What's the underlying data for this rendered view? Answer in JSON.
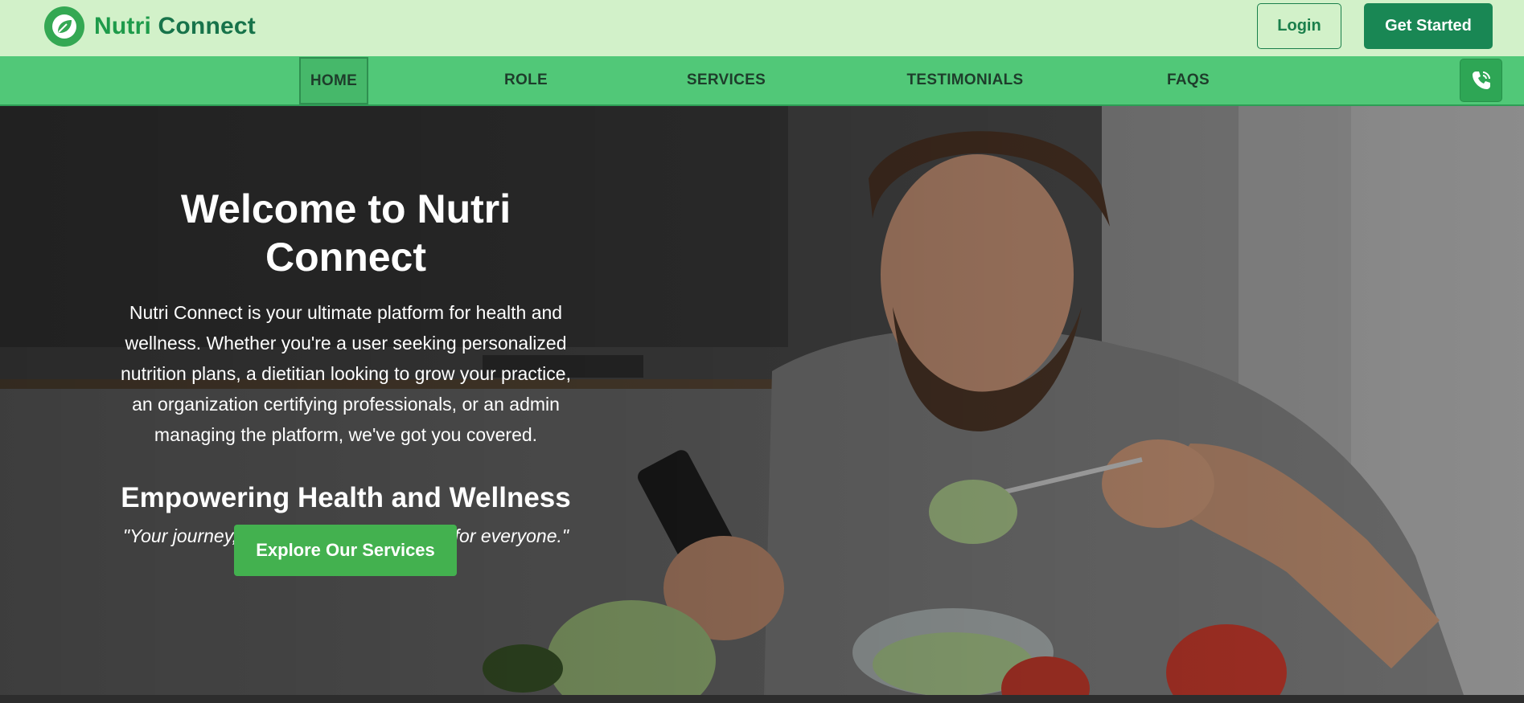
{
  "brand": {
    "name_part1": "Nutri",
    "name_part2": "Connect",
    "logo_icon": "leaf-icon",
    "colors": {
      "primary": "#198754",
      "accent": "#51c878",
      "header_bg": "#d2f1c9"
    }
  },
  "header": {
    "login_label": "Login",
    "get_started_label": "Get Started"
  },
  "nav": {
    "items": [
      {
        "label": "HOME",
        "active": true
      },
      {
        "label": "ROLE",
        "active": false
      },
      {
        "label": "SERVICES",
        "active": false
      },
      {
        "label": "TESTIMONIALS",
        "active": false
      },
      {
        "label": "FAQS",
        "active": false
      }
    ],
    "contact_icon": "phone-icon"
  },
  "hero": {
    "title": "Welcome to Nutri Connect",
    "description": "Nutri Connect is your ultimate platform for health and wellness. Whether you're a user seeking personalized nutrition plans, a dietitian looking to grow your practice, an organization certifying professionals, or an admin managing the platform, we've got you covered.",
    "subtitle": "Empowering Health and Wellness",
    "quote": "\"Your journey, our support, better health for everyone.\"",
    "cta_label": "Explore Our Services"
  }
}
